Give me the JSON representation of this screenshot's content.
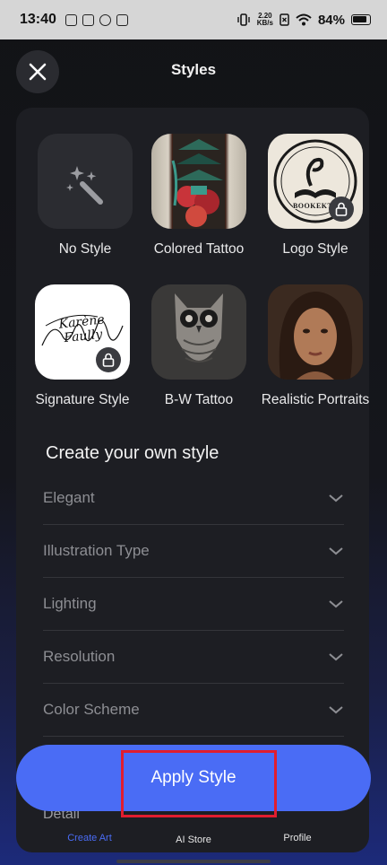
{
  "status_bar": {
    "time": "13:40",
    "net_speed_value": "2.20",
    "net_speed_unit": "KB/s",
    "battery": "84%"
  },
  "header": {
    "title": "Styles",
    "close_icon": "close-icon"
  },
  "styles": [
    {
      "label": "No Style",
      "locked": false
    },
    {
      "label": "Colored Tattoo",
      "locked": false
    },
    {
      "label": "Logo Style",
      "locked": true,
      "logo_text": "BOOKEKTA"
    },
    {
      "label": "Signature Style",
      "locked": true,
      "signature_text": "Karène Faully"
    },
    {
      "label": "B-W Tattoo",
      "locked": false
    },
    {
      "label": "Realistic Portraits",
      "locked": false
    }
  ],
  "custom_style": {
    "title": "Create your own style",
    "options": [
      "Elegant",
      "Illustration Type",
      "Lighting",
      "Resolution",
      "Color Scheme"
    ],
    "peek_option": "Detail"
  },
  "apply_button": {
    "label": "Apply Style"
  },
  "bottom_nav": {
    "items": [
      "Create Art",
      "AI Store",
      "Profile"
    ]
  },
  "colors": {
    "accent": "#4a6cf5",
    "highlight": "#e11d2e",
    "panel": "#1d1e23"
  }
}
